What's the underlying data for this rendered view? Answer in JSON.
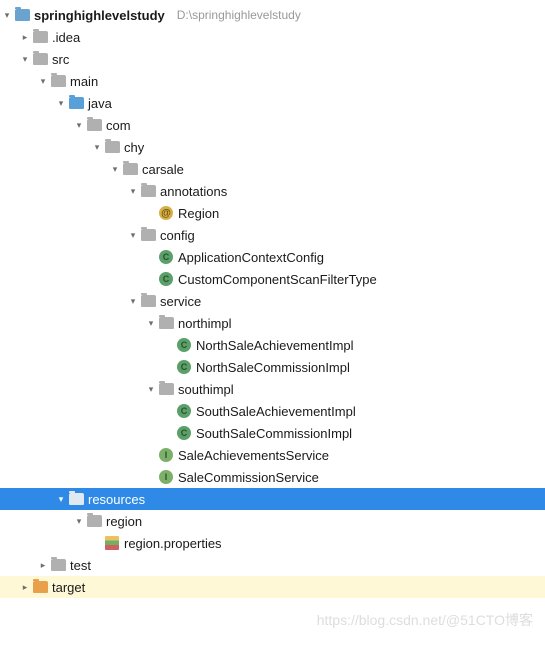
{
  "root": {
    "name": "springhighlevelstudy",
    "hint": "D:\\springhighlevelstudy"
  },
  "nodes": {
    "idea": ".idea",
    "src": "src",
    "main": "main",
    "java": "java",
    "com": "com",
    "chy": "chy",
    "carsale": "carsale",
    "annotations": "annotations",
    "Region": "Region",
    "config": "config",
    "ApplicationContextConfig": "ApplicationContextConfig",
    "CustomComponentScanFilterType": "CustomComponentScanFilterType",
    "service": "service",
    "northimpl": "northimpl",
    "NorthSaleAchievementImpl": "NorthSaleAchievementImpl",
    "NorthSaleCommissionImpl": "NorthSaleCommissionImpl",
    "southimpl": "southimpl",
    "SouthSaleAchievementImpl": "SouthSaleAchievementImpl",
    "SouthSaleCommissionImpl": "SouthSaleCommissionImpl",
    "SaleAchievementsService": "SaleAchievementsService",
    "SaleCommissionService": "SaleCommissionService",
    "resources": "resources",
    "region_folder": "region",
    "region_properties": "region.properties",
    "test": "test",
    "target": "target"
  },
  "watermark": "https://blog.csdn.net/@51CTO博客"
}
